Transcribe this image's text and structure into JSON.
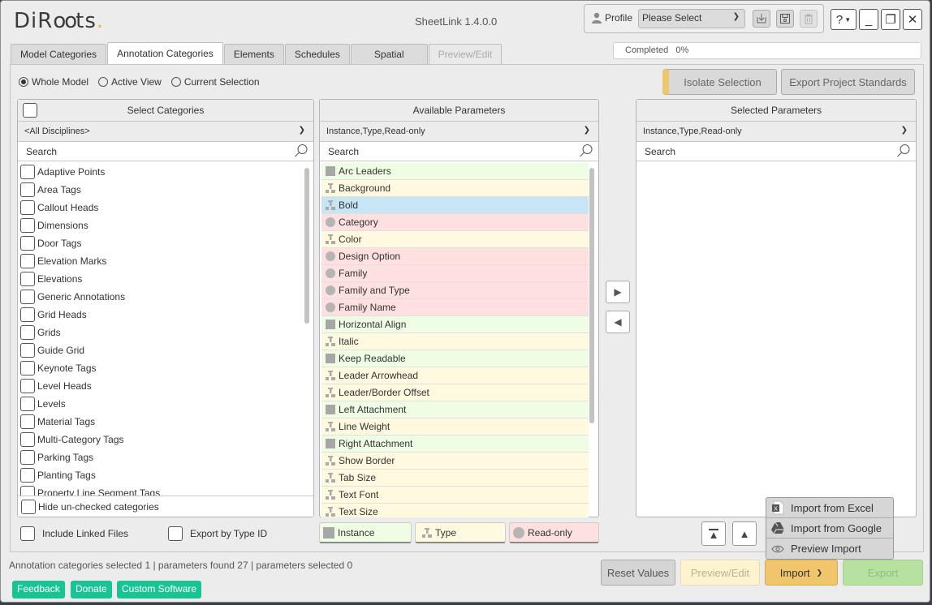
{
  "app": {
    "logo": "DiRoots",
    "title": "SheetLink 1.4.0.0"
  },
  "profile": {
    "label": "Profile",
    "selected": "Please Select",
    "icons": [
      "import-profile-icon",
      "save-profile-icon",
      "delete-profile-icon"
    ]
  },
  "window_controls": {
    "help": "?",
    "minimize": "_",
    "restore": "❐",
    "close": "✕"
  },
  "tabs": [
    {
      "label": "Model Categories",
      "state": "normal"
    },
    {
      "label": "Annotation Categories",
      "state": "active"
    },
    {
      "label": "Elements",
      "state": "normal"
    },
    {
      "label": "Schedules",
      "state": "normal"
    },
    {
      "label": "Spatial",
      "state": "normal"
    },
    {
      "label": "Preview/Edit",
      "state": "disabled"
    }
  ],
  "progress": {
    "label": "Completed",
    "value": "0%"
  },
  "scope": {
    "options": [
      "Whole Model",
      "Active View",
      "Current Selection"
    ],
    "selected": "Whole Model"
  },
  "actions": {
    "isolate": "Isolate Selection",
    "export_standards": "Export Project Standards"
  },
  "categories_panel": {
    "header": "Select Categories",
    "filter": "<All Disciplines>",
    "search_placeholder": "Search",
    "items": [
      "Adaptive Points",
      "Area Tags",
      "Callout Heads",
      "Dimensions",
      "Door Tags",
      "Elevation Marks",
      "Elevations",
      "Generic Annotations",
      "Grid Heads",
      "Grids",
      "Guide Grid",
      "Keynote Tags",
      "Level Heads",
      "Levels",
      "Material Tags",
      "Multi-Category Tags",
      "Parking Tags",
      "Planting Tags",
      "Property Line Segment Tags"
    ],
    "hide_unchecked": "Hide un-checked categories"
  },
  "available_panel": {
    "header": "Available Parameters",
    "filter": "Instance,Type,Read-only",
    "search_placeholder": "Search",
    "items": [
      {
        "label": "Arc Leaders",
        "kind": "instance"
      },
      {
        "label": "Background",
        "kind": "type"
      },
      {
        "label": "Bold",
        "kind": "type",
        "selected": true
      },
      {
        "label": "Category",
        "kind": "readonly"
      },
      {
        "label": "Color",
        "kind": "type"
      },
      {
        "label": "Design Option",
        "kind": "readonly"
      },
      {
        "label": "Family",
        "kind": "readonly"
      },
      {
        "label": "Family and Type",
        "kind": "readonly"
      },
      {
        "label": "Family Name",
        "kind": "readonly"
      },
      {
        "label": "Horizontal Align",
        "kind": "instance"
      },
      {
        "label": "Italic",
        "kind": "type"
      },
      {
        "label": "Keep Readable",
        "kind": "instance"
      },
      {
        "label": "Leader Arrowhead",
        "kind": "type"
      },
      {
        "label": "Leader/Border Offset",
        "kind": "type"
      },
      {
        "label": "Left Attachment",
        "kind": "instance"
      },
      {
        "label": "Line Weight",
        "kind": "type"
      },
      {
        "label": "Right Attachment",
        "kind": "instance"
      },
      {
        "label": "Show Border",
        "kind": "type"
      },
      {
        "label": "Tab Size",
        "kind": "type"
      },
      {
        "label": "Text Font",
        "kind": "type"
      },
      {
        "label": "Text Size",
        "kind": "type"
      }
    ]
  },
  "selected_panel": {
    "header": "Selected Parameters",
    "filter": "Instance,Type,Read-only",
    "search_placeholder": "Search",
    "items": []
  },
  "legend": {
    "instance": "Instance",
    "type": "Type",
    "readonly": "Read-only"
  },
  "options": {
    "include_linked": "Include Linked Files",
    "export_type_id": "Export by Type ID"
  },
  "status": "Annotation categories selected 1 | parameters found 27 | parameters selected 0",
  "links": [
    "Feedback",
    "Donate",
    "Custom Software"
  ],
  "footer": {
    "reset": "Reset Values",
    "preview": "Preview/Edit",
    "import": "Import",
    "export": "Export"
  },
  "import_menu": [
    {
      "label": "Import from Excel",
      "icon": "excel-icon"
    },
    {
      "label": "Import from Google",
      "icon": "google-drive-icon"
    },
    {
      "label": "Preview Import",
      "icon": "eye-icon"
    }
  ],
  "colors": {
    "instance": "#eefde4",
    "type": "#fef9df",
    "readonly": "#fde0df",
    "selected": "#c8e5f5",
    "accent_green": "#18c493",
    "import_orange": "#f0c56b",
    "isolate_accent": "#f0c66c"
  }
}
